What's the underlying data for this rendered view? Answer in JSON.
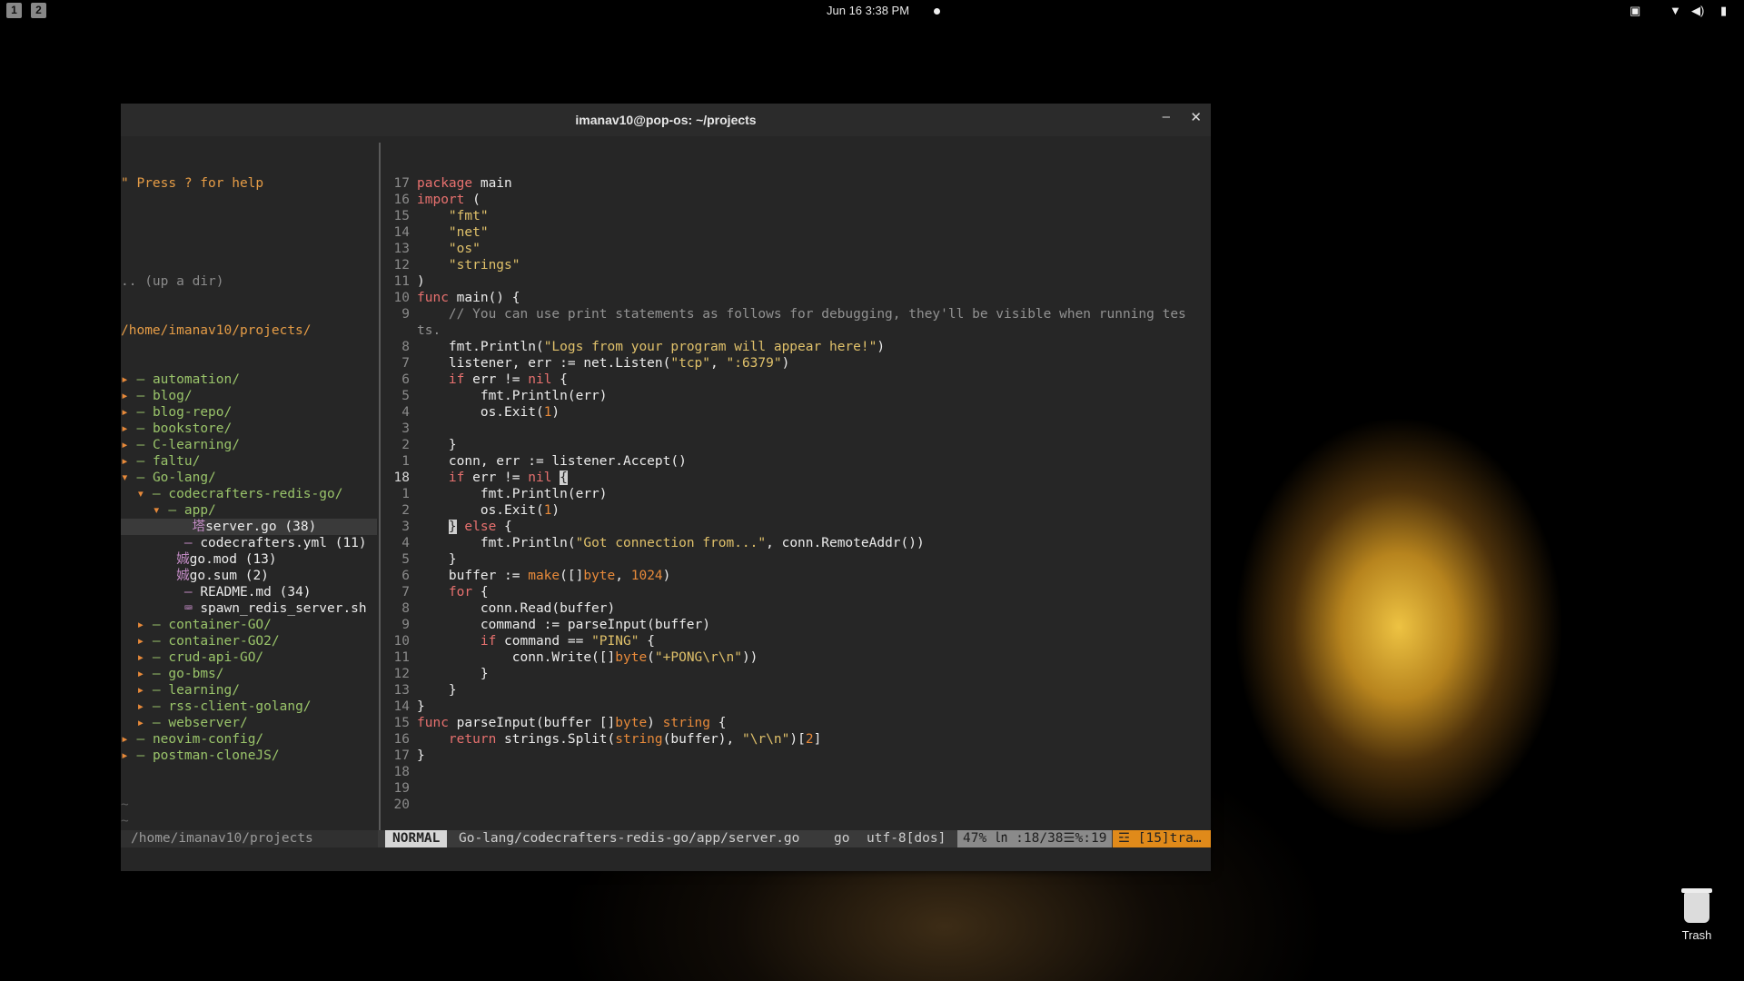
{
  "topbar": {
    "workspaces": [
      "1",
      "2"
    ],
    "clock": "Jun 16  3:38 PM",
    "tray_icons": [
      "screen-icon",
      "wifi-icon",
      "volume-icon",
      "battery-icon"
    ]
  },
  "window": {
    "title": "imanav10@pop-os: ~/projects",
    "minimize_label": "–",
    "close_label": "✕"
  },
  "tree": {
    "help": "\" Press ? for help",
    "up_dir": ".. (up a dir)",
    "root": "/home/imanav10/projects/",
    "items": [
      {
        "indent": "",
        "arrow": "▸",
        "prefix": " – ",
        "name": "automation/",
        "type": "dir"
      },
      {
        "indent": "",
        "arrow": "▸",
        "prefix": " – ",
        "name": "blog/",
        "type": "dir"
      },
      {
        "indent": "",
        "arrow": "▸",
        "prefix": " – ",
        "name": "blog-repo/",
        "type": "dir"
      },
      {
        "indent": "",
        "arrow": "▸",
        "prefix": " – ",
        "name": "bookstore/",
        "type": "dir"
      },
      {
        "indent": "",
        "arrow": "▸",
        "prefix": " – ",
        "name": "C-learning/",
        "type": "dir"
      },
      {
        "indent": "",
        "arrow": "▸",
        "prefix": " – ",
        "name": "faltu/",
        "type": "dir"
      },
      {
        "indent": "",
        "arrow": "▾",
        "prefix": " – ",
        "name": "Go-lang/",
        "type": "dir"
      },
      {
        "indent": "  ",
        "arrow": "▾",
        "prefix": " – ",
        "name": "codecrafters-redis-go/",
        "type": "dir"
      },
      {
        "indent": "    ",
        "arrow": "▾",
        "prefix": " – ",
        "name": "app/",
        "type": "dir"
      },
      {
        "indent": "         ",
        "arrow": "",
        "prefix": "塔",
        "name": "server.go (38)",
        "type": "file",
        "selected": true
      },
      {
        "indent": "       ",
        "arrow": "",
        "prefix": " – ",
        "name": "codecrafters.yml (11)",
        "type": "file"
      },
      {
        "indent": "       ",
        "arrow": "",
        "prefix": "娍",
        "name": "go.mod (13)",
        "type": "file"
      },
      {
        "indent": "       ",
        "arrow": "",
        "prefix": "娍",
        "name": "go.sum (2)",
        "type": "file"
      },
      {
        "indent": "       ",
        "arrow": "",
        "prefix": " – ",
        "name": "README.md (34)",
        "type": "file"
      },
      {
        "indent": "       ",
        "arrow": "",
        "prefix": " ⌨ ",
        "name": "spawn_redis_server.sh",
        "type": "file"
      },
      {
        "indent": "  ",
        "arrow": "▸",
        "prefix": " – ",
        "name": "container-GO/",
        "type": "dir"
      },
      {
        "indent": "  ",
        "arrow": "▸",
        "prefix": " – ",
        "name": "container-GO2/",
        "type": "dir"
      },
      {
        "indent": "  ",
        "arrow": "▸",
        "prefix": " – ",
        "name": "crud-api-GO/",
        "type": "dir"
      },
      {
        "indent": "  ",
        "arrow": "▸",
        "prefix": " – ",
        "name": "go-bms/",
        "type": "dir"
      },
      {
        "indent": "  ",
        "arrow": "▸",
        "prefix": " – ",
        "name": "learning/",
        "type": "dir"
      },
      {
        "indent": "  ",
        "arrow": "▸",
        "prefix": " – ",
        "name": "rss-client-golang/",
        "type": "dir"
      },
      {
        "indent": "  ",
        "arrow": "▸",
        "prefix": " – ",
        "name": "webserver/",
        "type": "dir"
      },
      {
        "indent": "",
        "arrow": "▸",
        "prefix": " – ",
        "name": "neovim-config/",
        "type": "dir"
      },
      {
        "indent": "",
        "arrow": "▸",
        "prefix": " – ",
        "name": "postman-cloneJS/",
        "type": "dir"
      }
    ],
    "tilde_count": 14
  },
  "editor": {
    "lines": [
      {
        "n": "17",
        "t": [
          [
            "kw",
            "package"
          ],
          [
            "fn",
            " main"
          ]
        ]
      },
      {
        "n": "16",
        "t": [
          [
            "kw",
            "import"
          ],
          [
            "fn",
            " ("
          ]
        ]
      },
      {
        "n": "15",
        "t": [
          [
            "fn",
            "    "
          ],
          [
            "str",
            "\"fmt\""
          ]
        ]
      },
      {
        "n": "14",
        "t": [
          [
            "fn",
            "    "
          ],
          [
            "str",
            "\"net\""
          ]
        ]
      },
      {
        "n": "13",
        "t": [
          [
            "fn",
            "    "
          ],
          [
            "str",
            "\"os\""
          ]
        ]
      },
      {
        "n": "12",
        "t": [
          [
            "fn",
            "    "
          ],
          [
            "str",
            "\"strings\""
          ]
        ]
      },
      {
        "n": "11",
        "t": [
          [
            "fn",
            ")"
          ]
        ]
      },
      {
        "n": "10",
        "t": [
          [
            "kw",
            "func"
          ],
          [
            "fn",
            " main() {"
          ]
        ]
      },
      {
        "n": "9",
        "t": [
          [
            "fn",
            "    "
          ],
          [
            "com",
            "// You can use print statements as follows for debugging, they'll be visible when running tes"
          ]
        ]
      },
      {
        "n": "",
        "t": [
          [
            "com",
            "ts."
          ]
        ]
      },
      {
        "n": "8",
        "t": [
          [
            "fn",
            "    fmt.Println("
          ],
          [
            "str",
            "\"Logs from your program will appear here!\""
          ],
          [
            "fn",
            ")"
          ]
        ]
      },
      {
        "n": "7",
        "t": [
          [
            "fn",
            "    listener, err := net.Listen("
          ],
          [
            "str",
            "\"tcp\""
          ],
          [
            "fn",
            ", "
          ],
          [
            "str",
            "\":6379\""
          ],
          [
            "fn",
            ")"
          ]
        ]
      },
      {
        "n": "6",
        "t": [
          [
            "fn",
            "    "
          ],
          [
            "kw",
            "if"
          ],
          [
            "fn",
            " err != "
          ],
          [
            "kw",
            "nil"
          ],
          [
            "fn",
            " {"
          ]
        ]
      },
      {
        "n": "5",
        "t": [
          [
            "fn",
            "        fmt.Println(err)"
          ]
        ]
      },
      {
        "n": "4",
        "t": [
          [
            "fn",
            "        os.Exit("
          ],
          [
            "num",
            "1"
          ],
          [
            "fn",
            ")"
          ]
        ]
      },
      {
        "n": "3",
        "t": [
          [
            "fn",
            ""
          ]
        ]
      },
      {
        "n": "2",
        "t": [
          [
            "fn",
            "    }"
          ]
        ]
      },
      {
        "n": "1",
        "t": [
          [
            "fn",
            "    conn, err := listener.Accept()"
          ]
        ]
      },
      {
        "n": "18",
        "cur": true,
        "t": [
          [
            "fn",
            "    "
          ],
          [
            "kw",
            "if"
          ],
          [
            "fn",
            " err != "
          ],
          [
            "kw",
            "nil"
          ],
          [
            "fn",
            " "
          ],
          [
            "cur",
            "{"
          ]
        ]
      },
      {
        "n": "1",
        "t": [
          [
            "fn",
            "        fmt.Println(err)"
          ]
        ]
      },
      {
        "n": "2",
        "t": [
          [
            "fn",
            "        os.Exit("
          ],
          [
            "num",
            "1"
          ],
          [
            "fn",
            ")"
          ]
        ]
      },
      {
        "n": "3",
        "t": [
          [
            "fn",
            "    "
          ],
          [
            "cur",
            "}"
          ],
          [
            "fn",
            " "
          ],
          [
            "kw",
            "else"
          ],
          [
            "fn",
            " {"
          ]
        ]
      },
      {
        "n": "4",
        "t": [
          [
            "fn",
            "        fmt.Println("
          ],
          [
            "str",
            "\"Got connection from...\""
          ],
          [
            "fn",
            ", conn.RemoteAddr())"
          ]
        ]
      },
      {
        "n": "5",
        "t": [
          [
            "fn",
            "    }"
          ]
        ]
      },
      {
        "n": "6",
        "t": [
          [
            "fn",
            "    buffer := "
          ],
          [
            "num",
            "make"
          ],
          [
            "fn",
            "([]"
          ],
          [
            "num",
            "byte"
          ],
          [
            "fn",
            ", "
          ],
          [
            "num",
            "1024"
          ],
          [
            "fn",
            ")"
          ]
        ]
      },
      {
        "n": "7",
        "t": [
          [
            "fn",
            "    "
          ],
          [
            "kw",
            "for"
          ],
          [
            "fn",
            " {"
          ]
        ]
      },
      {
        "n": "8",
        "t": [
          [
            "fn",
            "        conn.Read(buffer)"
          ]
        ]
      },
      {
        "n": "9",
        "t": [
          [
            "fn",
            "        command := parseInput(buffer)"
          ]
        ]
      },
      {
        "n": "10",
        "t": [
          [
            "fn",
            "        "
          ],
          [
            "kw",
            "if"
          ],
          [
            "fn",
            " command == "
          ],
          [
            "str",
            "\"PING\""
          ],
          [
            "fn",
            " {"
          ]
        ]
      },
      {
        "n": "11",
        "t": [
          [
            "fn",
            "            conn.Write([]"
          ],
          [
            "num",
            "byte"
          ],
          [
            "fn",
            "("
          ],
          [
            "str",
            "\"+PONG\\r\\n\""
          ],
          [
            "fn",
            "))"
          ]
        ]
      },
      {
        "n": "12",
        "t": [
          [
            "fn",
            "        }"
          ]
        ]
      },
      {
        "n": "13",
        "t": [
          [
            "fn",
            "    }"
          ]
        ]
      },
      {
        "n": "14",
        "t": [
          [
            "fn",
            "}"
          ]
        ]
      },
      {
        "n": "15",
        "t": [
          [
            "kw",
            "func"
          ],
          [
            "fn",
            " parseInput(buffer []"
          ],
          [
            "num",
            "byte"
          ],
          [
            "fn",
            ") "
          ],
          [
            "num",
            "string"
          ],
          [
            "fn",
            " {"
          ]
        ]
      },
      {
        "n": "16",
        "t": [
          [
            "fn",
            "    "
          ],
          [
            "kw",
            "return"
          ],
          [
            "fn",
            " strings.Split("
          ],
          [
            "num",
            "string"
          ],
          [
            "fn",
            "(buffer), "
          ],
          [
            "str",
            "\"\\r\\n\""
          ],
          [
            "fn",
            ")["
          ],
          [
            "num",
            "2"
          ],
          [
            "fn",
            "]"
          ]
        ]
      },
      {
        "n": "17",
        "t": [
          [
            "fn",
            "}"
          ]
        ]
      },
      {
        "n": "18",
        "t": [
          [
            "fn",
            ""
          ]
        ]
      },
      {
        "n": "19",
        "t": [
          [
            "fn",
            ""
          ]
        ]
      },
      {
        "n": "20",
        "t": [
          [
            "fn",
            ""
          ]
        ]
      }
    ],
    "tilde_count": 3
  },
  "statusbar": {
    "left_path": "/home/imanav10/projects",
    "mode": "NORMAL",
    "file": "Go-lang/codecrafters-redis-go/app/server.go",
    "filetype": "go",
    "encoding": "utf-8[dos]",
    "position": "47% ㏑ :18/38☰%:19",
    "warnings": "☲ [15]tra…"
  },
  "desktop": {
    "trash_label": "Trash"
  }
}
